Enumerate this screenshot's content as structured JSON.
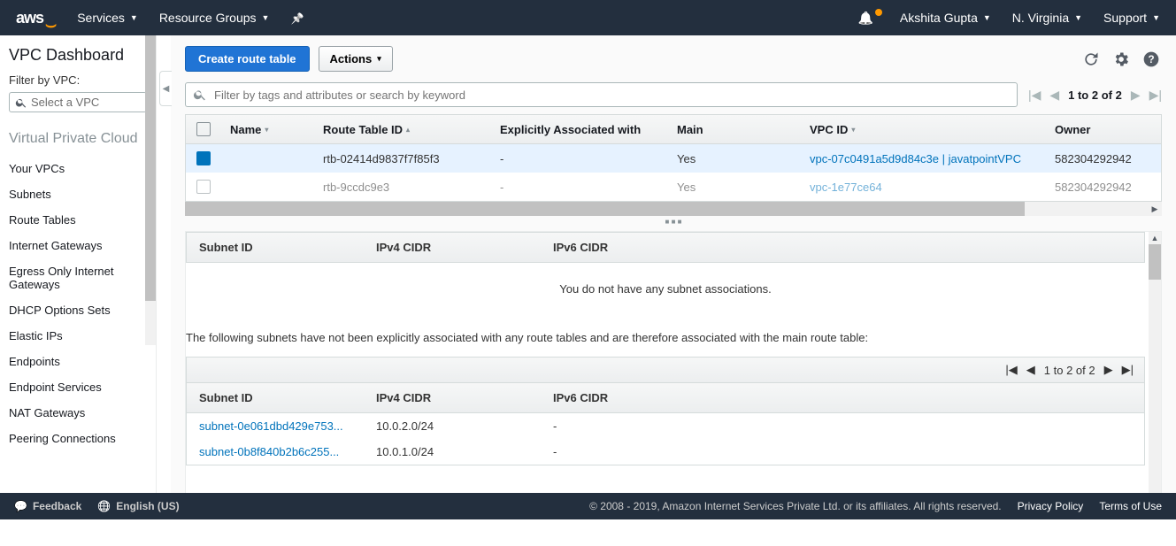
{
  "topnav": {
    "logo_text": "aws",
    "services": "Services",
    "resource_groups": "Resource Groups",
    "user": "Akshita Gupta",
    "region": "N. Virginia",
    "support": "Support"
  },
  "sidebar": {
    "title": "VPC Dashboard",
    "filter_label": "Filter by VPC:",
    "select_placeholder": "Select a VPC",
    "section": "Virtual Private Cloud",
    "links": [
      "Your VPCs",
      "Subnets",
      "Route Tables",
      "Internet Gateways",
      "Egress Only Internet Gateways",
      "DHCP Options Sets",
      "Elastic IPs",
      "Endpoints",
      "Endpoint Services",
      "NAT Gateways",
      "Peering Connections"
    ]
  },
  "toolbar": {
    "create": "Create route table",
    "actions": "Actions"
  },
  "search": {
    "placeholder": "Filter by tags and attributes or search by keyword"
  },
  "pager": {
    "range": "1 to 2 of 2"
  },
  "columns": {
    "name": "Name",
    "rtid": "Route Table ID",
    "assoc": "Explicitly Associated with",
    "main": "Main",
    "vpc": "VPC ID",
    "owner": "Owner"
  },
  "rows": [
    {
      "selected": true,
      "name": "",
      "rtid": "rtb-02414d9837f7f85f3",
      "assoc": "-",
      "main": "Yes",
      "vpc": "vpc-07c0491a5d9d84c3e | javatpointVPC",
      "owner": "582304292942"
    },
    {
      "selected": false,
      "name": "",
      "rtid": "rtb-9ccdc9e3",
      "assoc": "-",
      "main": "Yes",
      "vpc": "vpc-1e77ce64",
      "owner": "582304292942"
    }
  ],
  "assoc_table": {
    "headers": {
      "sid": "Subnet ID",
      "v4": "IPv4 CIDR",
      "v6": "IPv6 CIDR"
    },
    "empty": "You do not have any subnet associations."
  },
  "implicit": {
    "note": "The following subnets have not been explicitly associated with any route tables and are therefore associated with the main route table:",
    "pager": "1 to 2 of 2",
    "rows": [
      {
        "sid": "subnet-0e061dbd429e753...",
        "v4": "10.0.2.0/24",
        "v6": "-"
      },
      {
        "sid": "subnet-0b8f840b2b6c255...",
        "v4": "10.0.1.0/24",
        "v6": "-"
      }
    ]
  },
  "footer": {
    "feedback": "Feedback",
    "language": "English (US)",
    "copyright": "© 2008 - 2019, Amazon Internet Services Private Ltd. or its affiliates. All rights reserved.",
    "privacy": "Privacy Policy",
    "terms": "Terms of Use"
  }
}
